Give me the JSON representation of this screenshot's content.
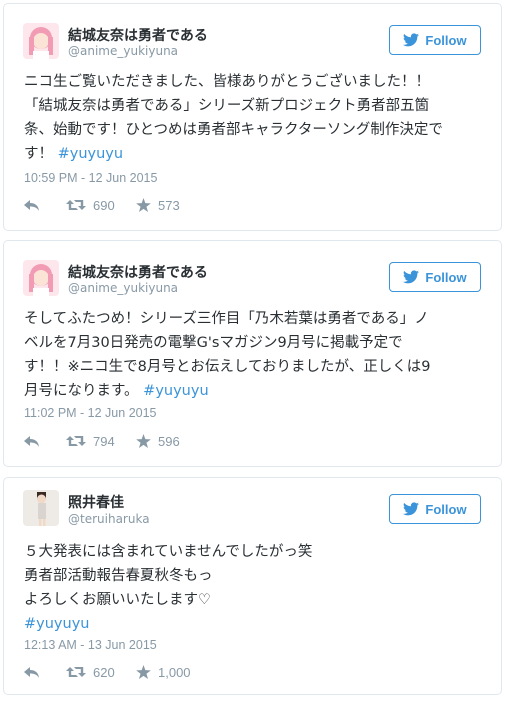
{
  "tweets": [
    {
      "name": "結城友奈は勇者である",
      "handle": "@anime_yukiyuna",
      "follow_label": "Follow",
      "text_lines": [
        "ニコ生ご覧いただきました、皆様ありがとうございました！！",
        "「結城友奈は勇者である」シリーズ新プロジェクト勇者部五箇",
        "条、始動です！ひとつめは勇者部キャラクターソング制作決定で",
        "す！"
      ],
      "hashtag": "#yuyuyu",
      "timestamp": "10:59 PM - 12 Jun 2015",
      "retweets": "690",
      "likes": "573"
    },
    {
      "name": "結城友奈は勇者である",
      "handle": "@anime_yukiyuna",
      "follow_label": "Follow",
      "text_lines": [
        "そしてふたつめ！シリーズ三作目「乃木若葉は勇者である」ノ",
        "ベルを7月30日発売の電撃G'sマガジン9月号に掲載予定で",
        "す！！※ニコ生で8月号とお伝えしておりましたが、正しくは9",
        "月号になります。"
      ],
      "hashtag": "#yuyuyu",
      "timestamp": "11:02 PM - 12 Jun 2015",
      "retweets": "794",
      "likes": "596"
    },
    {
      "name": "照井春佳",
      "handle": "@teruiharuka",
      "follow_label": "Follow",
      "text_lines": [
        "５大発表には含まれていませんでしたがっ笑",
        "勇者部活動報告春夏秋冬もっ",
        "よろしくお願いいたします♡"
      ],
      "hashtag": "#yuyuyu",
      "timestamp": "12:13 AM - 13 Jun 2015",
      "retweets": "620",
      "likes": "1,000"
    }
  ],
  "icons": {
    "follow": "twitter-bird-icon",
    "reply": "reply-icon",
    "retweet": "retweet-icon",
    "like": "star-icon"
  },
  "colors": {
    "accent": "#3b94d9",
    "muted": "#8899a6",
    "text": "#292f33",
    "border": "#e1e8ed"
  }
}
